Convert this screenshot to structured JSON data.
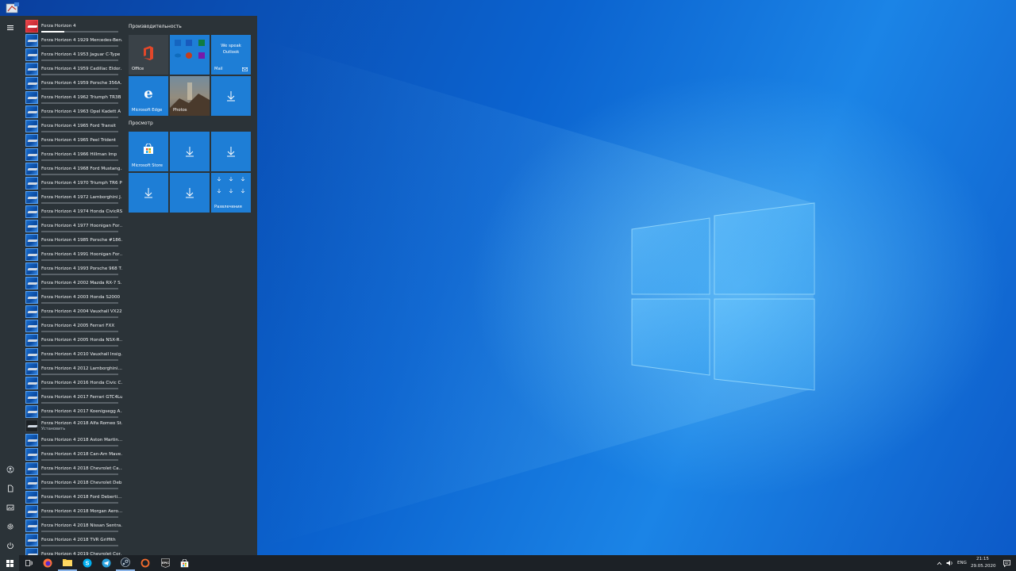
{
  "start_menu": {
    "apps": [
      {
        "label": "Forza Horizon 4",
        "type": "main",
        "progress": 0.3
      },
      {
        "label": "Forza Horizon 4 1929 Mercedes-Ben…",
        "progress": 0
      },
      {
        "label": "Forza Horizon 4 1953 Jaguar C-Type",
        "progress": 0
      },
      {
        "label": "Forza Horizon 4 1959 Cadillac Eldor…",
        "progress": 0
      },
      {
        "label": "Forza Horizon 4 1959 Porsche 356A…",
        "progress": 0
      },
      {
        "label": "Forza Horizon 4 1962 Triumph TR3B",
        "progress": 0
      },
      {
        "label": "Forza Horizon 4 1963 Opel Kadett A",
        "progress": 0
      },
      {
        "label": "Forza Horizon 4 1965 Ford Transit",
        "progress": 0
      },
      {
        "label": "Forza Horizon 4 1965 Peel Trident",
        "progress": 0
      },
      {
        "label": "Forza Horizon 4 1966 Hillman Imp",
        "progress": 0
      },
      {
        "label": "Forza Horizon 4 1968 Ford Mustang…",
        "progress": 0
      },
      {
        "label": "Forza Horizon 4 1970 Triumph TR6 PI",
        "progress": 0
      },
      {
        "label": "Forza Horizon 4 1972 Lamborghini J…",
        "progress": 0
      },
      {
        "label": "Forza Horizon 4 1974 Honda CivicRS",
        "progress": 0
      },
      {
        "label": "Forza Horizon 4 1977 Hoonigan For…",
        "progress": 0
      },
      {
        "label": "Forza Horizon 4 1985 Porsche #186…",
        "progress": 0
      },
      {
        "label": "Forza Horizon 4 1991 Hoonigan For…",
        "progress": 0
      },
      {
        "label": "Forza Horizon 4 1993 Porsche 968 T…",
        "progress": 0
      },
      {
        "label": "Forza Horizon 4 2002 Mazda RX-7 S…",
        "progress": 0
      },
      {
        "label": "Forza Horizon 4 2003 Honda S2000",
        "progress": 0
      },
      {
        "label": "Forza Horizon 4 2004 Vauxhall VX220",
        "progress": 0
      },
      {
        "label": "Forza Horizon 4 2005 Ferrari FXX",
        "progress": 0
      },
      {
        "label": "Forza Horizon 4 2005 Honda NSX-R…",
        "progress": 0
      },
      {
        "label": "Forza Horizon 4 2010 Vauxhall Insig…",
        "progress": 0
      },
      {
        "label": "Forza Horizon 4 2012 Lamborghini…",
        "progress": 0
      },
      {
        "label": "Forza Horizon 4 2016 Honda Civic C…",
        "progress": 0
      },
      {
        "label": "Forza Horizon 4 2017 Ferrari GTC4Lu…",
        "progress": 0
      },
      {
        "label": "Forza Horizon 4 2017 Koenigsegg A…",
        "progress": 0
      },
      {
        "label": "Forza Horizon 4 2018 Alfa Romeo St…",
        "type": "dark",
        "sub": "Установить"
      },
      {
        "label": "Forza Horizon 4 2018 Aston Martin…",
        "progress": 0
      },
      {
        "label": "Forza Horizon 4 2018 Can-Am Mave…",
        "progress": 0
      },
      {
        "label": "Forza Horizon 4 2018 Chevrolet Ca…",
        "progress": 0
      },
      {
        "label": "Forza Horizon 4 2018 Chevrolet Deb…",
        "progress": 0
      },
      {
        "label": "Forza Horizon 4 2018 Ford Deberti…",
        "progress": 0
      },
      {
        "label": "Forza Horizon 4 2018 Morgan Aero…",
        "progress": 0
      },
      {
        "label": "Forza Horizon 4 2018 Nissan Sentra…",
        "progress": 0
      },
      {
        "label": "Forza Horizon 4 2018 TVR Griffith",
        "progress": 0
      },
      {
        "label": "Forza Horizon 4 2019 Chevrolet Cor…",
        "progress": 0
      }
    ],
    "groups": {
      "productivity": "Производительность",
      "explore": "Просмотр"
    },
    "tiles": {
      "office": "Office",
      "mail": "Mail",
      "mail_promo": "We speak Outlook",
      "edge": "Microsoft Edge",
      "photos": "Photos",
      "store": "Microsoft Store",
      "entertainment": "Развлечения"
    }
  },
  "taskbar": {
    "language": "ENG",
    "time": "21:15",
    "date": "29.05.2020"
  },
  "colors": {
    "tile_blue": "#1e7ed6",
    "menu_bg": "#2b3338",
    "taskbar_bg": "#1c2126"
  }
}
